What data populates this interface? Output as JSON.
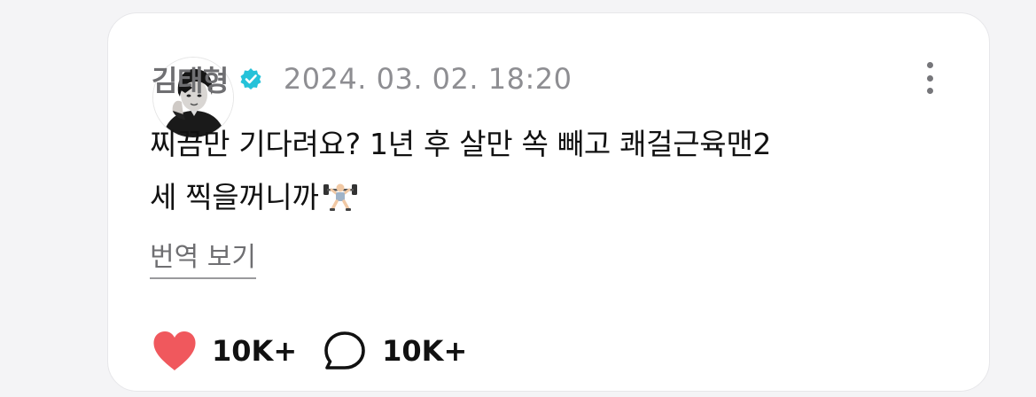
{
  "post": {
    "author": "김태형",
    "timestamp": "2024. 03. 02. 18:20",
    "line1": "찌끔만 기다려요? 1년 후 살만 쏙 빼고 쾌걸근육맨2",
    "line2": "세 찍을꺼니까",
    "emoji": "weightlifter-emoji",
    "translate_label": "번역 보기"
  },
  "actions": {
    "likes": "10K+",
    "comments": "10K+"
  },
  "colors": {
    "heart": "#f0585d",
    "verified": "#25c2d9",
    "muted_text": "#6f6f72",
    "card_bg": "#ffffff",
    "page_bg": "#f4f4f6"
  }
}
